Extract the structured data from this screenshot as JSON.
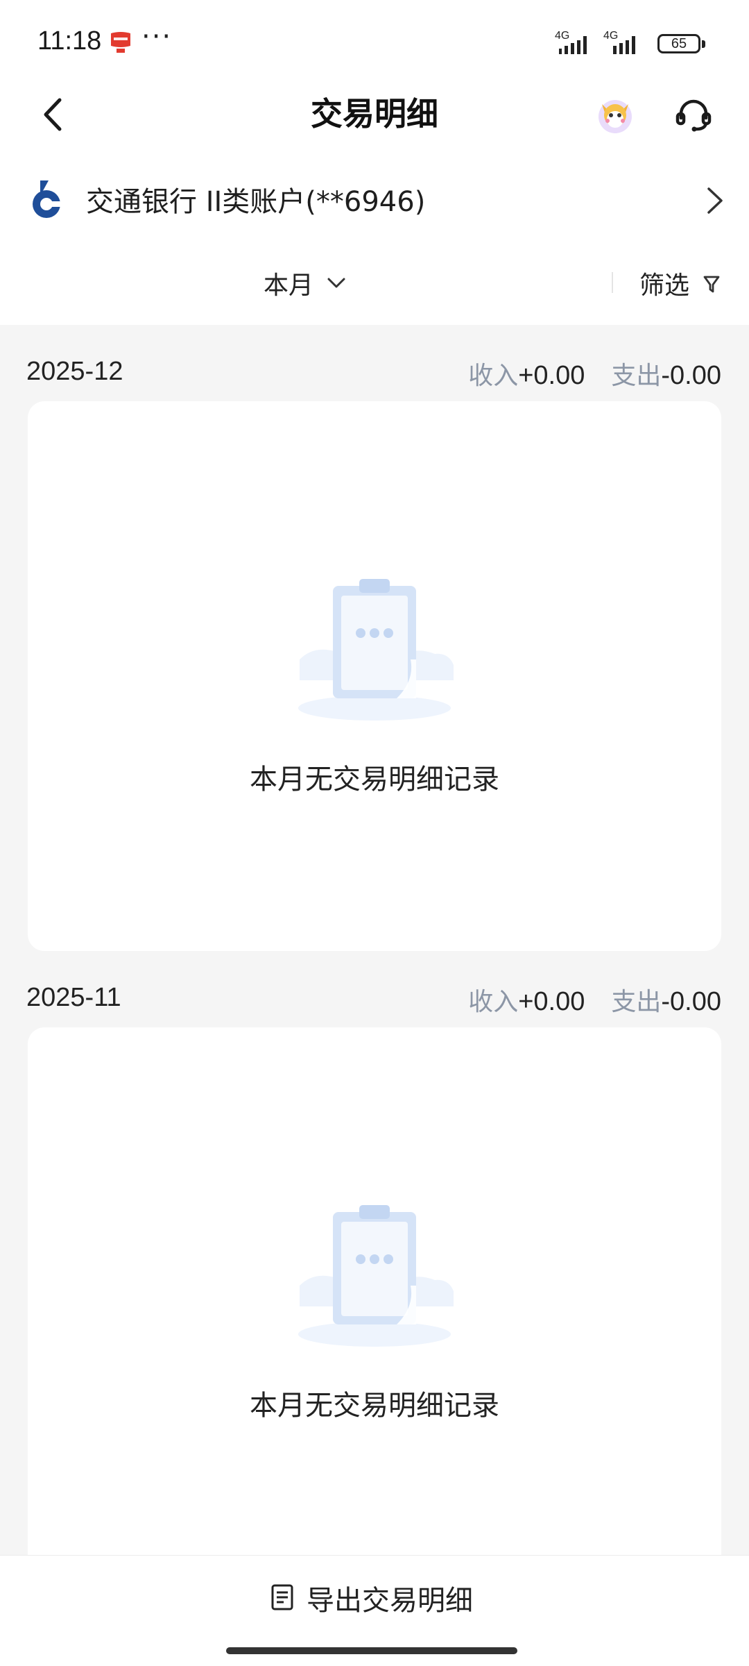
{
  "status_bar": {
    "time": "11:18",
    "more": "···",
    "network_1": "4G",
    "network_2": "4G",
    "battery": "65"
  },
  "nav": {
    "title": "交易明细",
    "icons": [
      "back-arrow-icon",
      "mascot-avatar-icon",
      "customer-service-headset-icon"
    ]
  },
  "account": {
    "name": "交通银行 II类账户(**6946)"
  },
  "filter": {
    "period": "本月",
    "filter_label": "筛选"
  },
  "months": [
    {
      "label": "2025-12",
      "income_key": "收入",
      "income_value": "+0.00",
      "expense_key": "支出",
      "expense_value": "-0.00",
      "empty_text": "本月无交易明细记录"
    },
    {
      "label": "2025-11",
      "income_key": "收入",
      "income_value": "+0.00",
      "expense_key": "支出",
      "expense_value": "-0.00",
      "empty_text": "本月无交易明细记录"
    }
  ],
  "bottom": {
    "export_label": "导出交易明细"
  },
  "colors": {
    "accent_blue": "#1f4e99",
    "muted_label": "#8c96a6",
    "page_bg": "#f5f5f5",
    "card_bg": "#ffffff"
  }
}
